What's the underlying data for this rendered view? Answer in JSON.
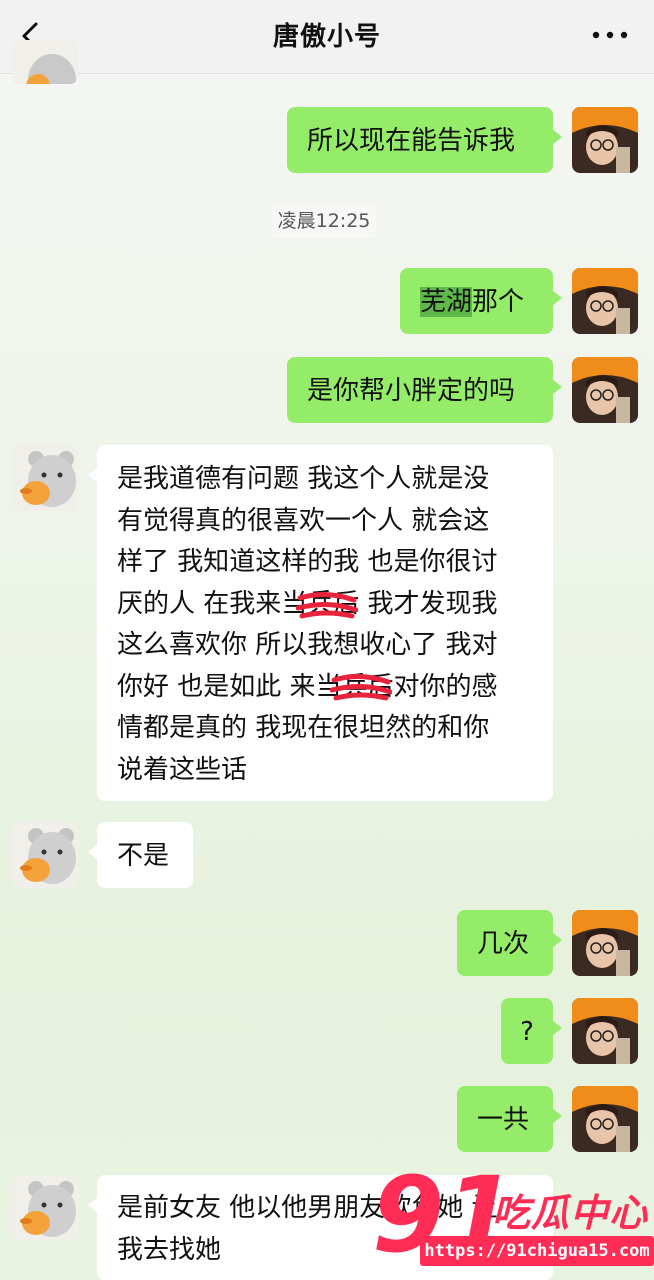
{
  "header": {
    "title": "唐傲小号",
    "back_icon": "chevron-left-icon",
    "more_icon": "more-horizontal-icon"
  },
  "chat": {
    "timestamp": "凌晨12:25",
    "messages": [
      {
        "from": "me",
        "text": "所以现在能告诉我"
      },
      {
        "from": "me",
        "text_highlight": "芜湖",
        "text_rest": "那个"
      },
      {
        "from": "me",
        "text": "是你帮小胖定的吗"
      },
      {
        "from": "other",
        "lines": [
          "是我道德有问题 我这个人就是没",
          "有觉得真的很喜欢一个人 就会这",
          "样了 我知道这样的我 也是你很讨",
          "厌的人  在我来当兵后 我才发现我",
          "这么喜欢你 所以我想收心了 我对",
          "你好 也是如此 来当兵后对你的感",
          "情都是真的 我现在很坦然的和你",
          "说着这些话"
        ]
      },
      {
        "from": "other",
        "text": "不是"
      },
      {
        "from": "me",
        "text": "几次"
      },
      {
        "from": "me",
        "text": "?"
      },
      {
        "from": "me",
        "text": "一共"
      },
      {
        "from": "other",
        "lines": [
          "是前女友 他以他男朋友欺负她 让",
          "我去找她"
        ]
      }
    ]
  },
  "watermark": {
    "number": "91",
    "text": "吃瓜中心",
    "url": "https://91chigua15.com"
  },
  "colors": {
    "me_bubble": "#95ec69",
    "other_bubble": "#ffffff",
    "watermark": "#ff2d55"
  }
}
